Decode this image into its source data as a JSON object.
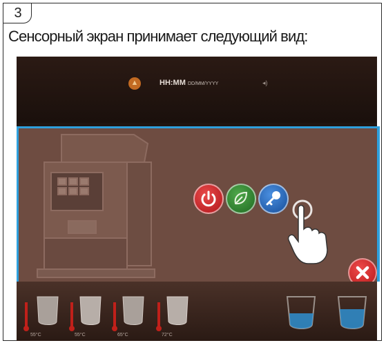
{
  "step": {
    "number": "3"
  },
  "caption": "Сенсорный экран принимает следующий вид:",
  "screen": {
    "status_bar": {
      "time": "HH:MM",
      "date": "DD/MM/YYYY",
      "warning_icon": "warning-icon",
      "volume_icon": "volume-icon"
    },
    "buttons": [
      {
        "name": "power-button",
        "icon": "power-icon",
        "color": "#c8202a"
      },
      {
        "name": "eco-button",
        "icon": "leaf-icon",
        "color": "#2f8a32"
      },
      {
        "name": "key-button",
        "icon": "key-icon",
        "color": "#2466c0"
      }
    ],
    "close_button": {
      "icon": "close-icon",
      "color": "#d02a2a"
    },
    "accent_color": "#2ea0dd",
    "pitchers": [
      {
        "temp": "55°C"
      },
      {
        "temp": "55°C"
      },
      {
        "temp": "65°C"
      },
      {
        "temp": "72°C"
      }
    ]
  }
}
